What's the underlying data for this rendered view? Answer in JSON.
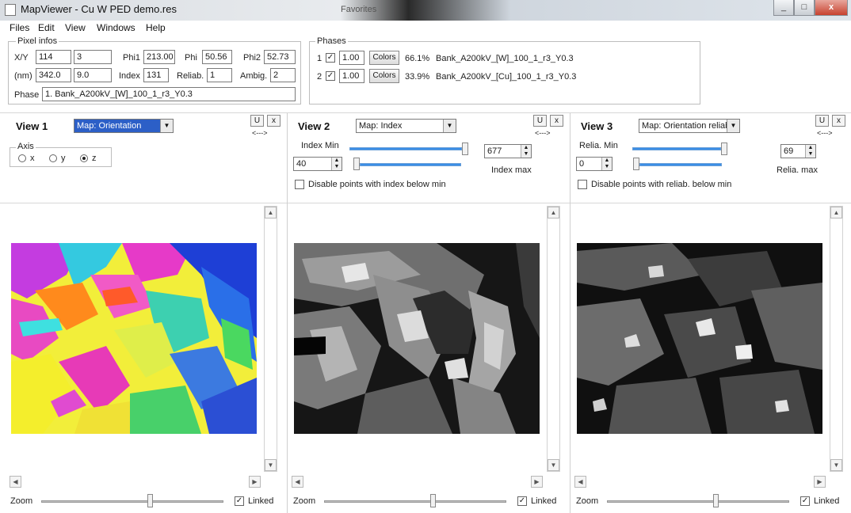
{
  "window": {
    "title": "MapViewer - Cu W PED demo.res",
    "background_tab": "Favorites",
    "controls": {
      "minimize": "_",
      "maximize": "□",
      "close": "x"
    }
  },
  "menu": [
    "Files",
    "Edit",
    "View",
    "Windows",
    "Help"
  ],
  "pixel_infos": {
    "group_title": "Pixel infos",
    "xy_label": "X/Y",
    "x": "114",
    "y": "3",
    "nm_label": "(nm)",
    "x_nm": "342.0",
    "y_nm": "9.0",
    "phi1_label": "Phi1",
    "phi1": "213.00",
    "phi_label": "Phi",
    "phi": "50.56",
    "phi2_label": "Phi2",
    "phi2": "52.73",
    "index_label": "Index",
    "index": "131",
    "reliab_label": "Reliab.",
    "reliab": "1",
    "ambig_label": "Ambig.",
    "ambig": "2",
    "phase_label": "Phase",
    "phase": "1. Bank_A200kV_[W]_100_1_r3_Y0.3"
  },
  "phases": {
    "group_title": "Phases",
    "colors_label": "Colors",
    "rows": [
      {
        "num": "1",
        "checked": "✓",
        "value": "1.00",
        "percent": "66.1%",
        "name": "Bank_A200kV_[W]_100_1_r3_Y0.3"
      },
      {
        "num": "2",
        "checked": "✓",
        "value": "1.00",
        "percent": "33.9%",
        "name": "Bank_A200kV_[Cu]_100_1_r3_Y0.3"
      }
    ]
  },
  "views": [
    {
      "label": "View 1",
      "map": "Map: Orientation",
      "axis_title": "Axis",
      "axes": [
        "x",
        "y",
        "z"
      ],
      "selected_axis": "z",
      "zoom_label": "Zoom",
      "linked_label": "Linked",
      "linked": "✓"
    },
    {
      "label": "View 2",
      "map": "Map: Index",
      "min_label": "Index Min",
      "min_value": "40",
      "max_label": "Index max",
      "max_value": "677",
      "disable_label": "Disable points with index below min",
      "zoom_label": "Zoom",
      "linked_label": "Linked",
      "linked": "✓"
    },
    {
      "label": "View 3",
      "map": "Map: Orientation reliab",
      "min_label": "Relia. Min",
      "min_value": "0",
      "max_label": "Relia. max",
      "max_value": "69",
      "disable_label": "Disable points with reliab. below min",
      "zoom_label": "Zoom",
      "linked_label": "Linked",
      "linked": "✓"
    }
  ],
  "common": {
    "u_btn": "U",
    "x_btn": "x",
    "arrows": "<--->"
  }
}
